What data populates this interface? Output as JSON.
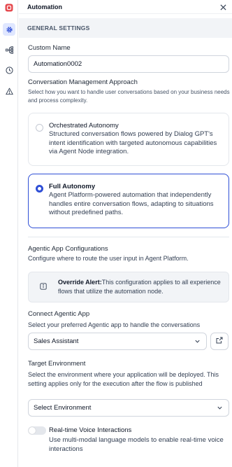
{
  "header": {
    "title": "Automation"
  },
  "section": {
    "title": "GENERAL SETTINGS"
  },
  "custom_name": {
    "label": "Custom Name",
    "value": "Automation0002"
  },
  "approach": {
    "label": "Conversation Management Approach",
    "help": "Select how you want to handle user conversations based on your business needs and process complexity.",
    "options": [
      {
        "title": "Orchestrated Autonomy",
        "desc": "Structured conversation flows powered by Dialog GPT's intent identification with targeted autonomous capabilities via Agent Node integration.",
        "selected": false
      },
      {
        "title": "Full Autonomy",
        "desc": "Agent Platform-powered automation that independently handles entire conversation flows, adapting to situations without predefined paths.",
        "selected": true
      }
    ]
  },
  "agentic": {
    "label": "Agentic App Configurations",
    "help": "Configure where to route the user input in Agent Platform.",
    "alert_title": "Override Alert:",
    "alert_text": "This configuration applies to all experience flows that utilize the automation node."
  },
  "connect": {
    "label": "Connect Agentic App",
    "help": "Select your preferred Agentic app to handle the conversations",
    "value": "Sales Assistant"
  },
  "target": {
    "label": "Target Environment",
    "help": "Select the environment where your application will be deployed. This setting applies only for the execution after the flow is published",
    "placeholder": "Select Environment"
  },
  "voice": {
    "label": "Real-time Voice Interactions",
    "desc": "Use multi-modal language models to enable real-time voice interactions",
    "enabled": false
  },
  "colors": {
    "accent": "#2f4fd6",
    "brand": "#e5484d",
    "band": "#f2f4f7"
  },
  "rail_icons": [
    "logo-icon",
    "gear-icon",
    "flow-icon",
    "clock-icon",
    "warning-icon"
  ]
}
